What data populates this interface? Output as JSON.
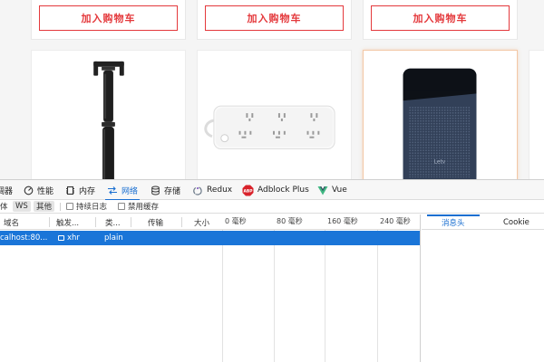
{
  "shop": {
    "cart_buttons": [
      "加入购物车",
      "加入购物车",
      "加入购物车"
    ],
    "products": [
      {
        "icon": "selfie-stick-image"
      },
      {
        "icon": "power-strip-image"
      },
      {
        "icon": "power-bank-image",
        "brand_mark": "Letv"
      }
    ]
  },
  "devtools": {
    "tabs": {
      "debugger": "调器",
      "performance": "性能",
      "memory": "内存",
      "network": "网络",
      "storage": "存储",
      "redux": "Redux",
      "adblock": "Adblock Plus",
      "vue": "Vue"
    },
    "filters": {
      "font": "体",
      "ws": "WS",
      "other": "其他",
      "persist_log": "持续日志",
      "disable_cache": "禁用缓存"
    },
    "columns": {
      "domain": "域名",
      "initiator": "触发...",
      "type": "类...",
      "transferred": "传输",
      "size": "大小",
      "t0": "0 毫秒",
      "t80": "80 毫秒",
      "t160": "160 毫秒",
      "t240": "240 毫秒"
    },
    "request": {
      "domain": "calhost:80...",
      "initiator": "xhr",
      "type": "plain"
    },
    "detail_tabs": {
      "headers": "消息头",
      "cookie": "Cookie"
    },
    "colors": {
      "accent": "#1a6fd1",
      "selected_row": "#1a75d8",
      "cart_red": "#e4393c",
      "adblock_red": "#d9232b",
      "vue_green": "#41b883"
    }
  }
}
